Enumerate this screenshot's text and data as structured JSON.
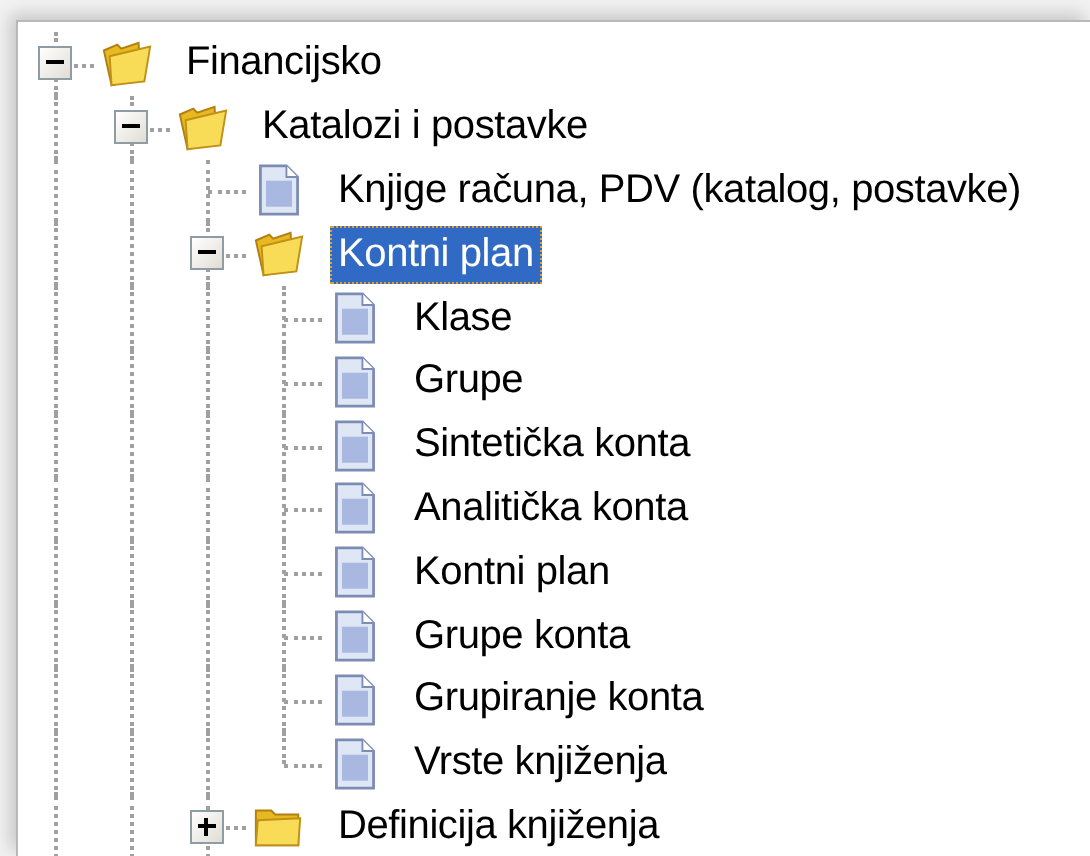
{
  "tree": [
    {
      "label": "Financijsko",
      "kind": "folder",
      "expanded": true,
      "selected": false,
      "children": [
        {
          "label": "Katalozi i postavke",
          "kind": "folder",
          "expanded": true,
          "selected": false,
          "children": [
            {
              "label": "Knjige računa, PDV (katalog, postavke)",
              "kind": "document",
              "selected": false
            },
            {
              "label": "Kontni plan",
              "kind": "folder",
              "expanded": true,
              "selected": true,
              "children": [
                {
                  "label": "Klase",
                  "kind": "document",
                  "selected": false
                },
                {
                  "label": "Grupe",
                  "kind": "document",
                  "selected": false
                },
                {
                  "label": "Sintetička konta",
                  "kind": "document",
                  "selected": false
                },
                {
                  "label": "Analitička konta",
                  "kind": "document",
                  "selected": false
                },
                {
                  "label": "Kontni plan",
                  "kind": "document",
                  "selected": false
                },
                {
                  "label": "Grupe konta",
                  "kind": "document",
                  "selected": false
                },
                {
                  "label": "Grupiranje konta",
                  "kind": "document",
                  "selected": false
                },
                {
                  "label": "Vrste knjiženja",
                  "kind": "document",
                  "selected": false
                }
              ]
            },
            {
              "label": "Definicija knjiženja",
              "kind": "folder",
              "expanded": false,
              "selected": false
            }
          ]
        }
      ]
    }
  ]
}
